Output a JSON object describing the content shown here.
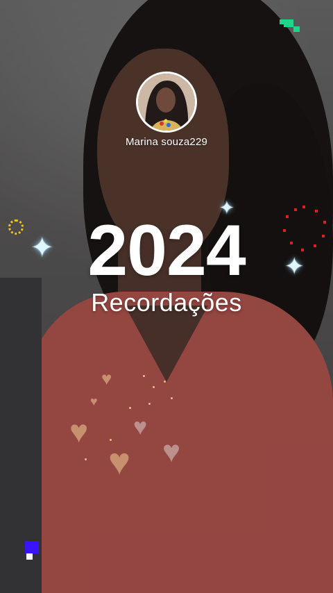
{
  "profile": {
    "username": "Marina souza229",
    "avatar_icon": "profile-photo"
  },
  "recap": {
    "year": "2024",
    "title": "Recordações"
  },
  "colors": {
    "text": "#ffffff",
    "sprite_green": "#1ed68a",
    "sun_yellow": "#f3c51c",
    "dots_red": "#e0201f",
    "corner_blue": "#3a14ff",
    "shirt_coral": "#b55650"
  },
  "decorations": {
    "sparkle_glyph": "✦",
    "heart_glyph": "♥"
  }
}
